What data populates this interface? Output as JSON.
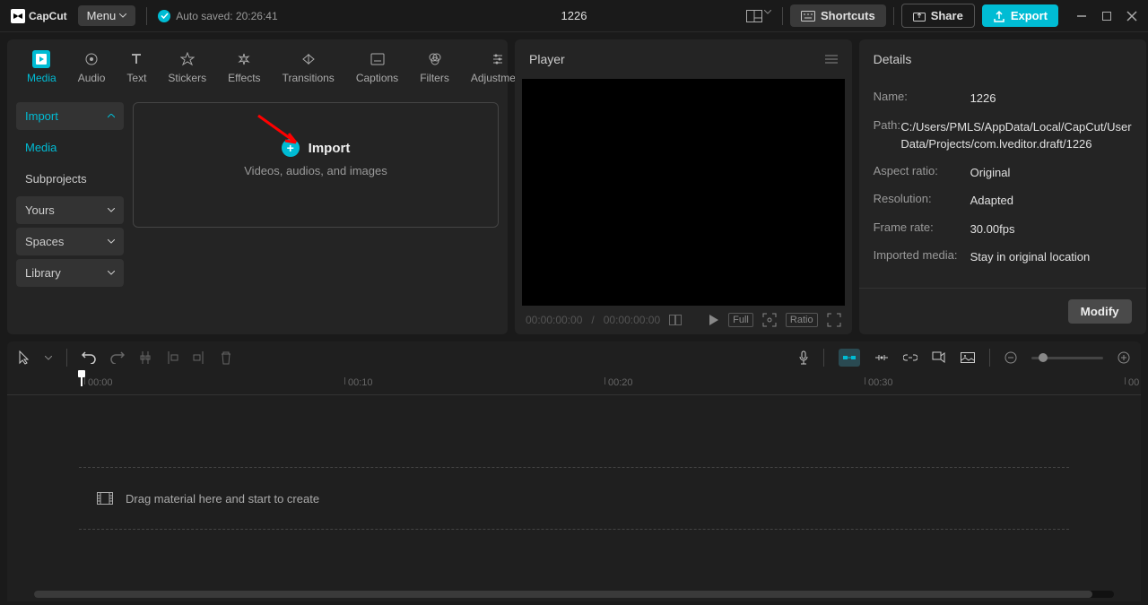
{
  "titlebar": {
    "app": "CapCut",
    "menu": "Menu",
    "autosave": "Auto saved: 20:26:41",
    "project": "1226",
    "shortcuts": "Shortcuts",
    "share": "Share",
    "export": "Export"
  },
  "mediaTabs": [
    {
      "label": "Media"
    },
    {
      "label": "Audio"
    },
    {
      "label": "Text"
    },
    {
      "label": "Stickers"
    },
    {
      "label": "Effects"
    },
    {
      "label": "Transitions"
    },
    {
      "label": "Captions"
    },
    {
      "label": "Filters"
    },
    {
      "label": "Adjustment"
    }
  ],
  "sidebar": {
    "import": "Import",
    "media": "Media",
    "subprojects": "Subprojects",
    "yours": "Yours",
    "spaces": "Spaces",
    "library": "Library"
  },
  "importArea": {
    "title": "Import",
    "subtitle": "Videos, audios, and images"
  },
  "player": {
    "title": "Player",
    "timecode_current": "00:00:00:00",
    "timecode_total": "00:00:00:00",
    "full": "Full",
    "ratio": "Ratio"
  },
  "details": {
    "title": "Details",
    "name_label": "Name:",
    "name_value": "1226",
    "path_label": "Path:",
    "path_value": "C:/Users/PMLS/AppData/Local/CapCut/User Data/Projects/com.lveditor.draft/1226",
    "aspect_label": "Aspect ratio:",
    "aspect_value": "Original",
    "res_label": "Resolution:",
    "res_value": "Adapted",
    "fps_label": "Frame rate:",
    "fps_value": "30.00fps",
    "imported_label": "Imported media:",
    "imported_value": "Stay in original location",
    "modify": "Modify"
  },
  "timeline": {
    "marks": [
      "00:00",
      "00:10",
      "00:20",
      "00:30",
      "00"
    ],
    "drop_hint": "Drag material here and start to create"
  }
}
